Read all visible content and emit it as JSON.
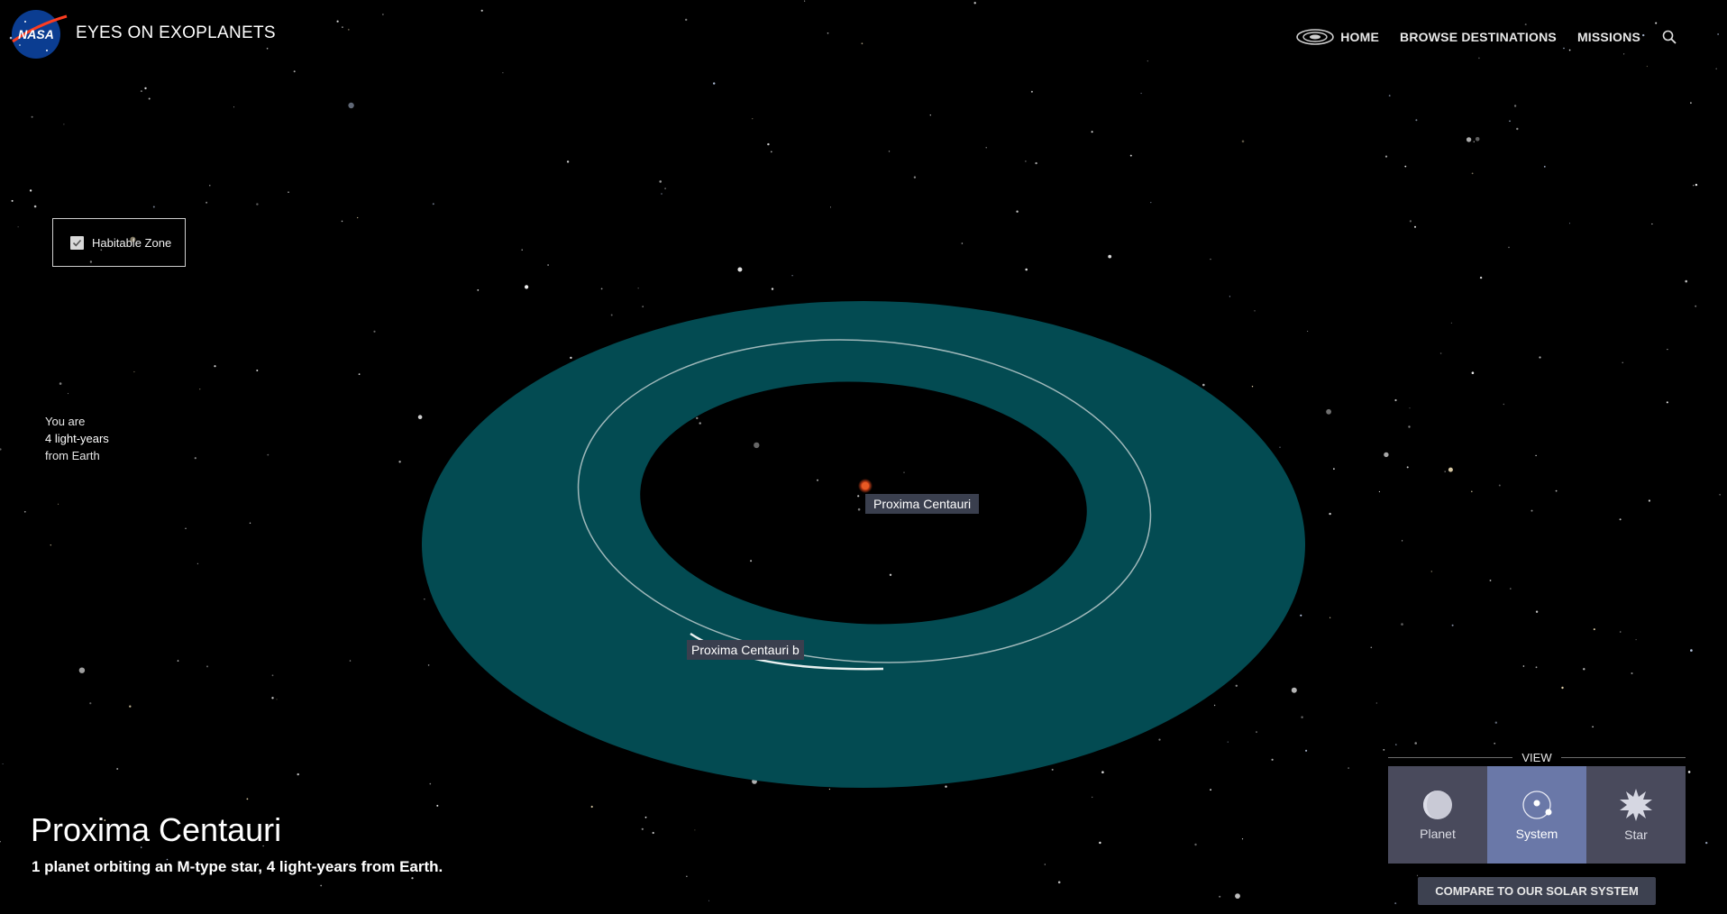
{
  "header": {
    "logo_text": "NASA",
    "app_title": "EYES ON EXOPLANETS",
    "nav": [
      {
        "label": "HOME",
        "icon": "galaxy-icon"
      },
      {
        "label": "BROWSE DESTINATIONS"
      },
      {
        "label": "MISSIONS"
      }
    ],
    "search_icon": "search-icon"
  },
  "habitable_zone": {
    "label": "Habitable Zone",
    "checked": true
  },
  "distance": {
    "line1": "You are",
    "line2": "4 light-years",
    "line3": "from Earth"
  },
  "scene": {
    "star_label": "Proxima Centauri",
    "planet_label": "Proxima Centauri b",
    "zone_color": "#034b52",
    "star_color": "#d9451a"
  },
  "info": {
    "title": "Proxima Centauri",
    "description": "1 planet orbiting an M-type star, 4 light-years from Earth."
  },
  "view_panel": {
    "header": "VIEW",
    "buttons": [
      {
        "label": "Planet",
        "active": false
      },
      {
        "label": "System",
        "active": true
      },
      {
        "label": "Star",
        "active": false
      }
    ],
    "compare_label": "COMPARE TO OUR SOLAR SYSTEM"
  },
  "colors": {
    "background": "#000000",
    "active_view": "#6a78a8",
    "inactive_view": "#494a5c",
    "label_bg": "#3a3f4e"
  }
}
